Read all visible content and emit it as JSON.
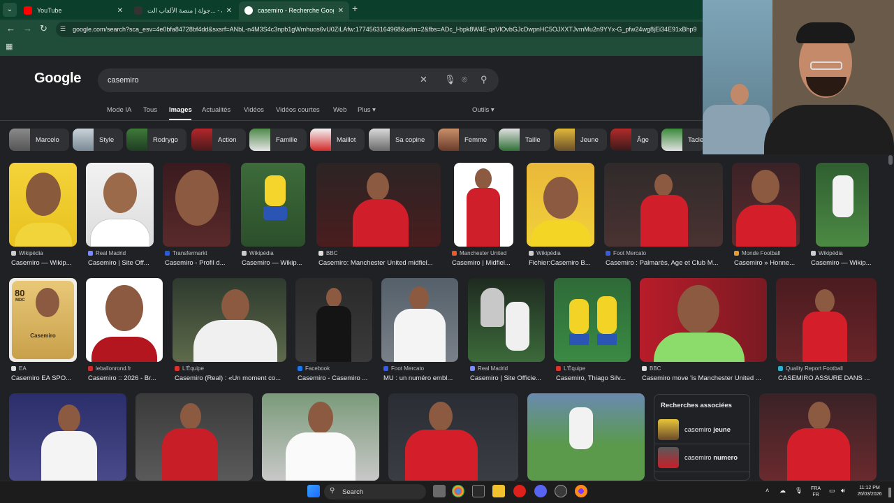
{
  "browser": {
    "tabs": [
      {
        "title": "YouTube",
        "favicon_color": "#ff0000"
      },
      {
        "title": "جولة | منصة الألعاب الت... - Jawlah",
        "favicon_color": "#1a1a1a"
      },
      {
        "title": "casemiro - Recherche Google",
        "favicon_color": "#ffffff"
      }
    ],
    "url": "google.com/search?sca_esv=4e0bfa84728bf4dd&sxsrf=ANbL-n4M3S4c3npb1gWmhuos6vU0ZiLAfw:1774563164968&udm=2&fbs=ADc_l-bpk8W4E-qsVlOvbGJcDwpnHC5OJXXTJvmMu2n9YYx-G_pfw24wg8jEi34E91xBhp9"
  },
  "google": {
    "logo": "Google",
    "query": "casemiro",
    "nav": [
      "Mode IA",
      "Tous",
      "Images",
      "Actualités",
      "Vidéos",
      "Vidéos courtes",
      "Web",
      "Plus ▾"
    ],
    "tools": "Outils ▾"
  },
  "chips": [
    "Marcelo",
    "Style",
    "Rodrygo",
    "Action",
    "Famille",
    "Maillot",
    "Sa copine",
    "Femme",
    "Taille",
    "Jeune",
    "Âge",
    "Tacle"
  ],
  "rows": [
    [
      {
        "source": "Wikipédia",
        "caption": "Casemiro — Wikip..."
      },
      {
        "source": "Real Madrid",
        "caption": "Casemiro | Site Off..."
      },
      {
        "source": "Transfermarkt",
        "caption": "Casemiro - Profil d..."
      },
      {
        "source": "Wikipédia",
        "caption": "Casemiro — Wikip..."
      },
      {
        "source": "BBC",
        "caption": "Casemiro: Manchester United midfiel..."
      },
      {
        "source": "Manchester United",
        "caption": "Casemiro | Midfiel..."
      },
      {
        "source": "Wikipédia",
        "caption": "Fichier:Casemiro B..."
      },
      {
        "source": "Foot Mercato",
        "caption": "Casemiro : Palmarès, Age et Club M..."
      },
      {
        "source": "Monde Football",
        "caption": "Casemiro » Honne..."
      },
      {
        "source": "Wikipédia",
        "caption": "Casemiro — Wikip..."
      }
    ],
    [
      {
        "source": "EA",
        "caption": "Casemiro EA SPO..."
      },
      {
        "source": "leballonrond.fr",
        "caption": "Casemiro :: 2026 - Br..."
      },
      {
        "source": "L'Équipe",
        "caption": "Casemiro (Real) : «Un moment co..."
      },
      {
        "source": "Facebook",
        "caption": "Casemiro - Casemiro ..."
      },
      {
        "source": "Foot Mercato",
        "caption": "MU : un numéro embl..."
      },
      {
        "source": "Real Madrid",
        "caption": "Casemiro | Site Officie..."
      },
      {
        "source": "L'Équipe",
        "caption": "Casemiro, Thiago Silv..."
      },
      {
        "source": "BBC",
        "caption": "Casemiro move 'is Manchester United ..."
      },
      {
        "source": "Quality Report Football",
        "caption": "CASEMIRO ASSURE DANS ..."
      }
    ]
  ],
  "fifa_card": {
    "rating": "80",
    "position": "MDC",
    "name": "Casemiro"
  },
  "related": {
    "title": "Recherches associées",
    "items": [
      {
        "prefix": "casemiro ",
        "bold": "jeune"
      },
      {
        "prefix": "casemiro ",
        "bold": "numero"
      }
    ]
  },
  "taskbar": {
    "search": "Search",
    "lang_top": "FRA",
    "lang_bottom": "FR",
    "time": "11:12 PM",
    "date": "26/03/2026"
  }
}
